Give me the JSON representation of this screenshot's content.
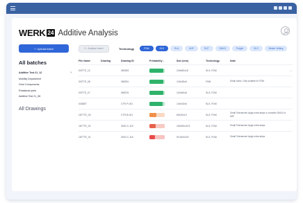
{
  "brand": {
    "logo": "WERK",
    "logo_box": "24",
    "title": "Additive Analysis"
  },
  "sidebar": {
    "upload_label": "Upload batch",
    "all_batches": "All batches",
    "batches": [
      {
        "label": "Additive Test 21_12",
        "active": true
      },
      {
        "label": "Mobility Department",
        "active": false
      },
      {
        "label": "Gear Components",
        "active": false
      },
      {
        "label": "Rotational parts",
        "active": false
      },
      {
        "label": "Additive Test 21_08",
        "active": false
      }
    ],
    "all_drawings": "All Drawings"
  },
  "toolbar": {
    "analyse_label": "Analyse batch",
    "technology_label": "Technology",
    "chips": [
      {
        "label": "FDM",
        "active": true
      },
      {
        "label": "SLS",
        "active": true
      },
      {
        "label": "SLA",
        "active": false
      },
      {
        "label": "MJF",
        "active": false
      },
      {
        "label": "DLP",
        "active": false
      },
      {
        "label": "DMLS",
        "active": false
      },
      {
        "label": "Polyjet",
        "active": false
      },
      {
        "label": "SLS",
        "active": false
      },
      {
        "label": "Binder Jetting",
        "active": false
      }
    ]
  },
  "table": {
    "headers": [
      "File Name",
      "Drawing",
      "Drawing ID",
      "Printability ↓",
      "Size (mm)",
      "Technology",
      "Note"
    ],
    "rows": [
      {
        "file": "00ITTE_12",
        "drawing_id": "083393",
        "printability": 0.9,
        "bar_color": "#2fb36b",
        "size": "240x80x18",
        "technology": "SLS, FDM",
        "note": ""
      },
      {
        "file": "00ITTE_08",
        "drawing_id": "085391",
        "printability": 0.9,
        "bar_color": "#2fb36b",
        "size": "140x35x6",
        "technology": "FDM",
        "note": "Small holes. Only suitable for FDM"
      },
      {
        "file": "00ITTE_07",
        "drawing_id": "085376",
        "printability": 0.9,
        "bar_color": "#2fb36b",
        "size": "120x60x8",
        "technology": "SLS, FDM",
        "note": ""
      },
      {
        "file": "0338ST",
        "drawing_id": "CTR-P-001",
        "printability": 0.85,
        "bar_color": "#2fb36b",
        "size": "140x33x6",
        "technology": "SLS, FDM",
        "note": ""
      },
      {
        "file": "1877TE_03",
        "drawing_id": "CTR-B-001",
        "printability": 0.45,
        "bar_color": "#f08f4a",
        "size": "80x20x10",
        "technology": "SLS, FDM",
        "note": "Small Tolerances! Apply extra steps or consider DMLS or MJF"
      },
      {
        "file": "1877TE_02",
        "drawing_id": "3002-C-115",
        "printability": 0.4,
        "bar_color": "#e8604a",
        "size": "150x90x42.5",
        "technology": "SLS, FDM",
        "note": "Small Tolerances! Apply extra steps"
      },
      {
        "file": "1877TE_01",
        "drawing_id": "3002-C-115",
        "printability": 0.35,
        "bar_color": "#e84a4a",
        "size": "94.5x20x20",
        "technology": "SLS, FDM",
        "note": "Small Tolerances! Apply extra steps"
      }
    ],
    "row_menu": "…"
  }
}
